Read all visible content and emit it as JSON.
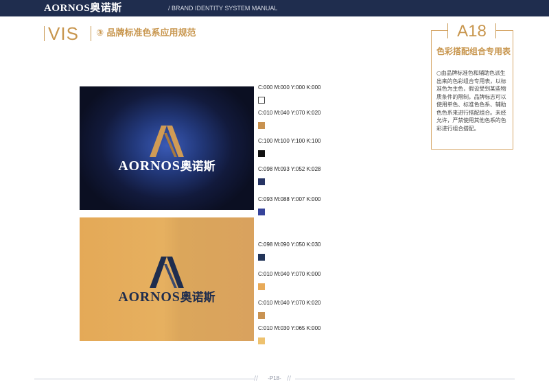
{
  "header": {
    "brand": "AORNOS奥诺斯",
    "manual_title": "/ BRAND IDENTITY SYSTEM MANUAL"
  },
  "section": {
    "code": "VIS",
    "title": "③ 品牌标准色系应用规范"
  },
  "panel": {
    "tab": "A18",
    "title": "色彩搭配组合专用表",
    "description": "○由品牌标准色和辅助色派生出来的色彩组合专用表，以标准色为主色，假设受到某些物质条件的限制，品牌标志可以使用单色、标准色色系、辅助色色系来进行搭配组合。未经允许，严禁使用其他色系的色彩进行组合搭配。"
  },
  "logo": {
    "wordmark": "AORNOS",
    "chinese": "奥诺斯"
  },
  "colors": {
    "header_bg": "#1f2d4e",
    "accent_gold": "#c8964e",
    "navy": "#1f2d4e"
  },
  "swatches": [
    {
      "label": "C:000  M:000  Y:000  K:000",
      "color": "#ffffff"
    },
    {
      "label": "C:010  M:040  Y:070  K:020",
      "color": "#c89250"
    },
    {
      "label": "C:100  M:100  Y:100  K:100",
      "color": "#111111"
    },
    {
      "label": "C:098  M:093  Y:052  K:028",
      "color": "#263463"
    },
    {
      "label": "C:093  M:088  Y:007  K:000",
      "color": "#36439a"
    },
    {
      "label": "C:098  M:090  Y:050  K:030",
      "color": "#233559"
    },
    {
      "label": "C:010  M:040  Y:070  K:000",
      "color": "#e8aa58"
    },
    {
      "label": "C:010  M:040  Y:070  K:020",
      "color": "#c99352"
    },
    {
      "label": "C:010  M:030  Y:065  K:000",
      "color": "#eec26f"
    }
  ],
  "footer": {
    "page": "-P18-"
  }
}
